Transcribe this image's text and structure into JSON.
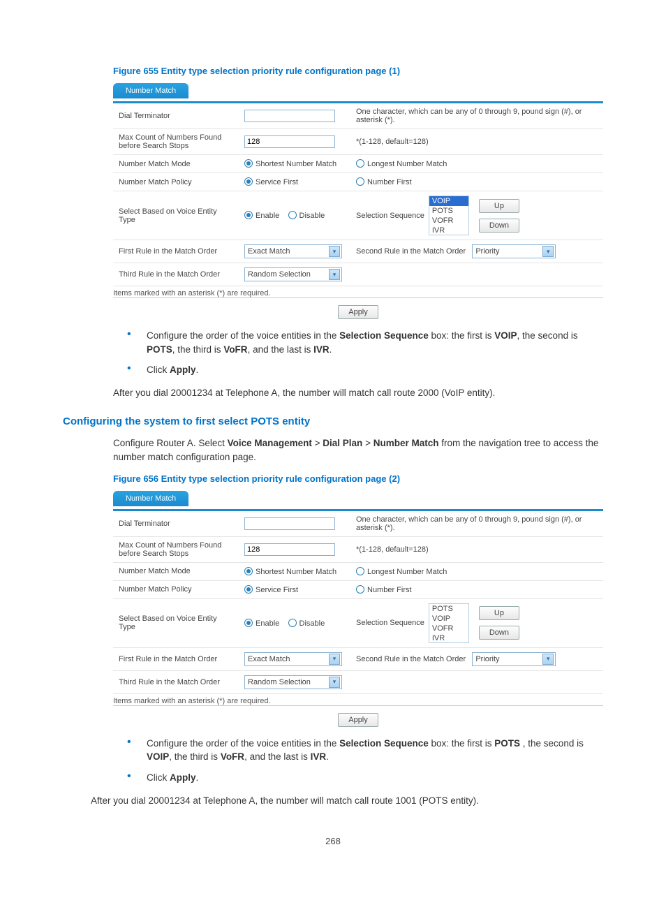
{
  "figure1": {
    "caption": "Figure 655 Entity type selection priority rule configuration page (1)",
    "tab": "Number Match",
    "rows": {
      "dial_terminator_label": "Dial Terminator",
      "dial_terminator_value": "",
      "dial_terminator_hint": "One character, which can be any of 0 through 9, pound sign (#), or asterisk (*).",
      "max_count_label": "Max Count of Numbers Found before Search Stops",
      "max_count_value": "128",
      "max_count_hint": "*(1-128, default=128)",
      "match_mode_label": "Number Match Mode",
      "match_mode_opt1": "Shortest Number Match",
      "match_mode_opt2": "Longest Number Match",
      "match_policy_label": "Number Match Policy",
      "match_policy_opt1": "Service First",
      "match_policy_opt2": "Number First",
      "voice_entity_label": "Select Based on Voice Entity Type",
      "enable": "Enable",
      "disable": "Disable",
      "sel_seq_label": "Selection Sequence",
      "sel_seq_items": [
        "VOIP",
        "POTS",
        "VOFR",
        "IVR"
      ],
      "up": "Up",
      "down": "Down",
      "first_rule_label": "First Rule in the Match Order",
      "first_rule_value": "Exact Match",
      "second_rule_label": "Second Rule in the Match Order",
      "second_rule_value": "Priority",
      "third_rule_label": "Third Rule in the Match Order",
      "third_rule_value": "Random Selection"
    },
    "footnote": "Items marked with an asterisk (*) are required.",
    "apply": "Apply"
  },
  "bullets1": {
    "b1_pre": "Configure the order of the voice entities in the ",
    "b1_selseq": "Selection Sequence",
    "b1_mid1": " box: the first is ",
    "b1_v1": "VOIP",
    "b1_mid2": ", the second is ",
    "b1_v2": "POTS",
    "b1_mid3": ", the third is ",
    "b1_v3": "VoFR",
    "b1_mid4": ", and the last is ",
    "b1_v4": "IVR",
    "b1_end": ".",
    "b2_pre": "Click ",
    "b2_apply": "Apply",
    "b2_end": "."
  },
  "after1": "After you dial 20001234 at Telephone A, the number will match call route 2000 (VoIP entity).",
  "heading2": "Configuring the system to first select POTS entity",
  "para2_pre": "Configure Router A. Select ",
  "para2_vm": "Voice Management",
  "para2_gt1": " > ",
  "para2_dp": "Dial Plan",
  "para2_gt2": " > ",
  "para2_nm": "Number Match",
  "para2_post": " from the navigation tree to access the number match configuration page.",
  "figure2": {
    "caption": "Figure 656 Entity type selection priority rule configuration page (2)",
    "tab": "Number Match",
    "rows": {
      "dial_terminator_label": "Dial Terminator",
      "dial_terminator_value": "",
      "dial_terminator_hint": "One character, which can be any of 0 through 9, pound sign (#), or asterisk (*).",
      "max_count_label": "Max Count of Numbers Found before Search Stops",
      "max_count_value": "128",
      "max_count_hint": "*(1-128, default=128)",
      "match_mode_label": "Number Match Mode",
      "match_mode_opt1": "Shortest Number Match",
      "match_mode_opt2": "Longest Number Match",
      "match_policy_label": "Number Match Policy",
      "match_policy_opt1": "Service First",
      "match_policy_opt2": "Number First",
      "voice_entity_label": "Select Based on Voice Entity Type",
      "enable": "Enable",
      "disable": "Disable",
      "sel_seq_label": "Selection Sequence",
      "sel_seq_items": [
        "POTS",
        "VOIP",
        "VOFR",
        "IVR"
      ],
      "up": "Up",
      "down": "Down",
      "first_rule_label": "First Rule in the Match Order",
      "first_rule_value": "Exact Match",
      "second_rule_label": "Second Rule in the Match Order",
      "second_rule_value": "Priority",
      "third_rule_label": "Third Rule in the Match Order",
      "third_rule_value": "Random Selection"
    },
    "footnote": "Items marked with an asterisk (*) are required.",
    "apply": "Apply"
  },
  "bullets2": {
    "b1_pre": "Configure the order of the voice entities in the ",
    "b1_selseq": "Selection Sequence",
    "b1_mid1": " box: the first is ",
    "b1_v1": "POTS ",
    "b1_mid2": ", the second is ",
    "b1_v2": "VOIP",
    "b1_mid3": ", the third is ",
    "b1_v3": "VoFR",
    "b1_mid4": ", and the last is ",
    "b1_v4": "IVR",
    "b1_end": ".",
    "b2_pre": "Click ",
    "b2_apply": "Apply",
    "b2_end": "."
  },
  "after2": "After you dial 20001234 at Telephone A, the number will match call route 1001 (POTS entity).",
  "pagenum": "268"
}
